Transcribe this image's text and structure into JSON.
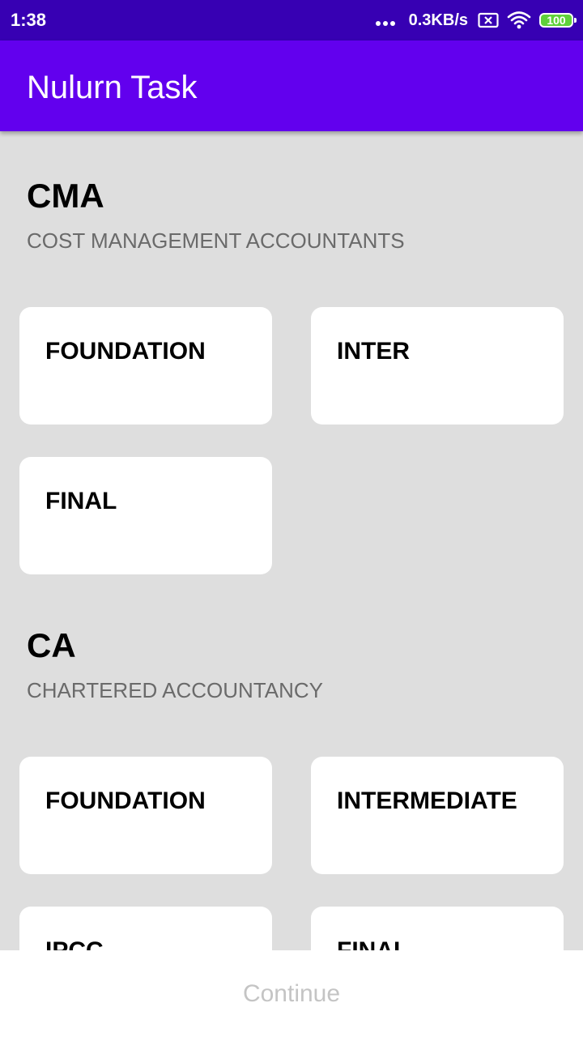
{
  "status_bar": {
    "time": "1:38",
    "network_speed": "0.3KB/s",
    "battery_level": "100",
    "icons": [
      "more-dots-icon",
      "sim-error-icon",
      "wifi-icon",
      "battery-icon"
    ]
  },
  "app_bar": {
    "title": "Nulurn Task",
    "background": "#6200ee"
  },
  "sections": [
    {
      "title": "CMA",
      "subtitle": "COST MANAGEMENT ACCOUNTANTS",
      "cards": [
        {
          "label": "FOUNDATION"
        },
        {
          "label": "INTER"
        },
        {
          "label": "FINAL"
        }
      ]
    },
    {
      "title": "CA",
      "subtitle": "CHARTERED ACCOUNTANCY",
      "cards": [
        {
          "label": "FOUNDATION"
        },
        {
          "label": "INTERMEDIATE"
        },
        {
          "label": "IPCC"
        },
        {
          "label": "FINAL"
        }
      ]
    }
  ],
  "footer": {
    "continue_label": "Continue",
    "enabled": false
  },
  "colors": {
    "status_bar": "#3700b3",
    "app_bar": "#6200ee",
    "background": "#dedede",
    "card": "#ffffff",
    "disabled_text": "#c4c4c4"
  }
}
